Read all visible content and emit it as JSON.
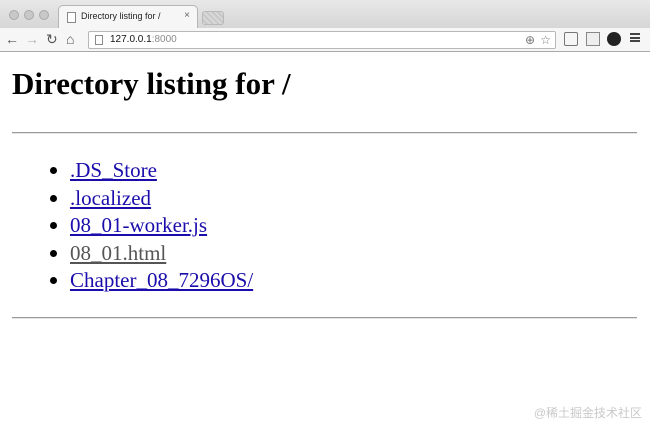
{
  "browser": {
    "tab": {
      "title": "Directory listing for /",
      "close_glyph": "×"
    },
    "toolbar": {
      "back_glyph": "←",
      "forward_glyph": "→",
      "reload_glyph": "↻",
      "home_glyph": "⌂"
    },
    "address": {
      "host": "127.0.0.1",
      "port": ":8000",
      "zoom_glyph": "⊕",
      "star_glyph": "☆"
    }
  },
  "page": {
    "heading": "Directory listing for /",
    "entries": [
      {
        "name": ".DS_Store",
        "visited": false
      },
      {
        "name": ".localized",
        "visited": false
      },
      {
        "name": "08_01-worker.js",
        "visited": false
      },
      {
        "name": "08_01.html",
        "visited": true
      },
      {
        "name": "Chapter_08_7296OS/",
        "visited": false
      }
    ]
  },
  "watermark": "@稀土掘金技术社区",
  "colors": {
    "link": "#1a0dab",
    "visited_link": "#555555",
    "chrome": "#f6f6f6"
  }
}
